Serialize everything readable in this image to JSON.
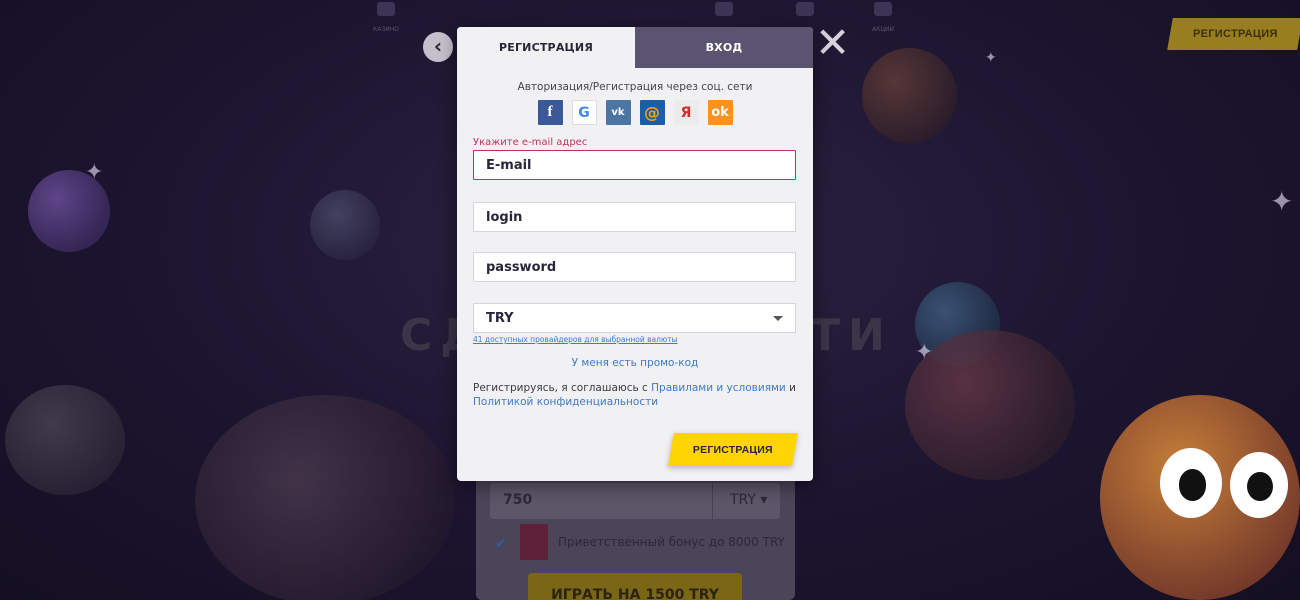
{
  "background": {
    "nav_items": [
      {
        "icon": "casino-icon",
        "label": "КАЗИНО"
      },
      {
        "icon": "nav-icon",
        "label": ""
      },
      {
        "icon": "nav-icon",
        "label": ""
      },
      {
        "icon": "nav-icon",
        "label": ""
      },
      {
        "icon": "nav-icon",
        "label": ""
      },
      {
        "icon": "promo-icon",
        "label": "АКЦИИ"
      }
    ],
    "top_register_label": "РЕГИСТРАЦИЯ",
    "hero_left": "СД",
    "hero_right": "ТИ",
    "amount": "750",
    "amount_currency": "TRY",
    "bonus_text": "Приветственный бонус до 8000 TRY",
    "play_label": "ИГРАТЬ НА 1500 TRY"
  },
  "modal": {
    "tabs": {
      "register": "РЕГИСТРАЦИЯ",
      "login": "ВХОД"
    },
    "social_title": "Авторизация/Регистрация через соц. сети",
    "social": [
      {
        "name": "facebook",
        "glyph": "f"
      },
      {
        "name": "google",
        "glyph": "G"
      },
      {
        "name": "vk",
        "glyph": "vk"
      },
      {
        "name": "mailru",
        "glyph": "@"
      },
      {
        "name": "yandex",
        "glyph": "Я"
      },
      {
        "name": "odnoklassniki",
        "glyph": "ok"
      }
    ],
    "email_error": "Укажите e-mail адрес",
    "email_placeholder": "E-mail",
    "login_placeholder": "login",
    "password_placeholder": "password",
    "currency": "TRY",
    "providers_link": "41 доступных провайдеров для выбранной валюты",
    "promo_link": "У меня есть промо-код",
    "terms_prefix": "Регистрируясь, я соглашаюсь с ",
    "terms_link1": "Правилами и условиями",
    "terms_and": " и ",
    "terms_link2": "Политикой конфиденциальности",
    "submit_label": "РЕГИСТРАЦИЯ"
  },
  "colors": {
    "accent_yellow": "#ffd400",
    "tab_inactive": "#5b5470",
    "error": "#c2335c",
    "link": "#3e7bc9"
  }
}
